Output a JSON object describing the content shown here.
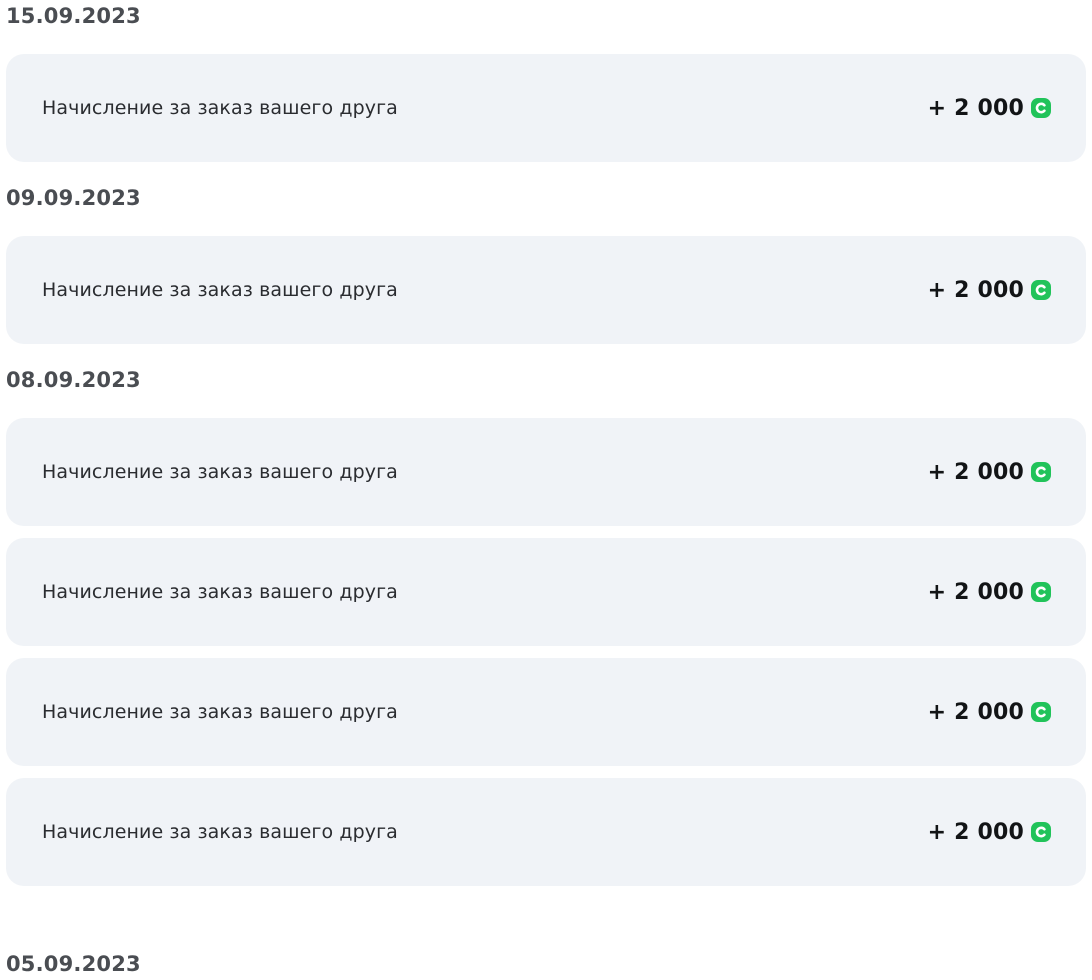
{
  "accent": "#21c35a",
  "currency_icon": "green-coin-icon",
  "groups": [
    {
      "date": "15.09.2023",
      "rows": [
        {
          "label": "Начисление за заказ вашего друга",
          "amount": "+ 2 000"
        }
      ]
    },
    {
      "date": "09.09.2023",
      "rows": [
        {
          "label": "Начисление за заказ вашего друга",
          "amount": "+ 2 000"
        }
      ]
    },
    {
      "date": "08.09.2023",
      "rows": [
        {
          "label": "Начисление за заказ вашего друга",
          "amount": "+ 2 000"
        },
        {
          "label": "Начисление за заказ вашего друга",
          "amount": "+ 2 000"
        },
        {
          "label": "Начисление за заказ вашего друга",
          "amount": "+ 2 000"
        },
        {
          "label": "Начисление за заказ вашего друга",
          "amount": "+ 2 000"
        }
      ]
    }
  ],
  "next_group_date": "05.09.2023"
}
